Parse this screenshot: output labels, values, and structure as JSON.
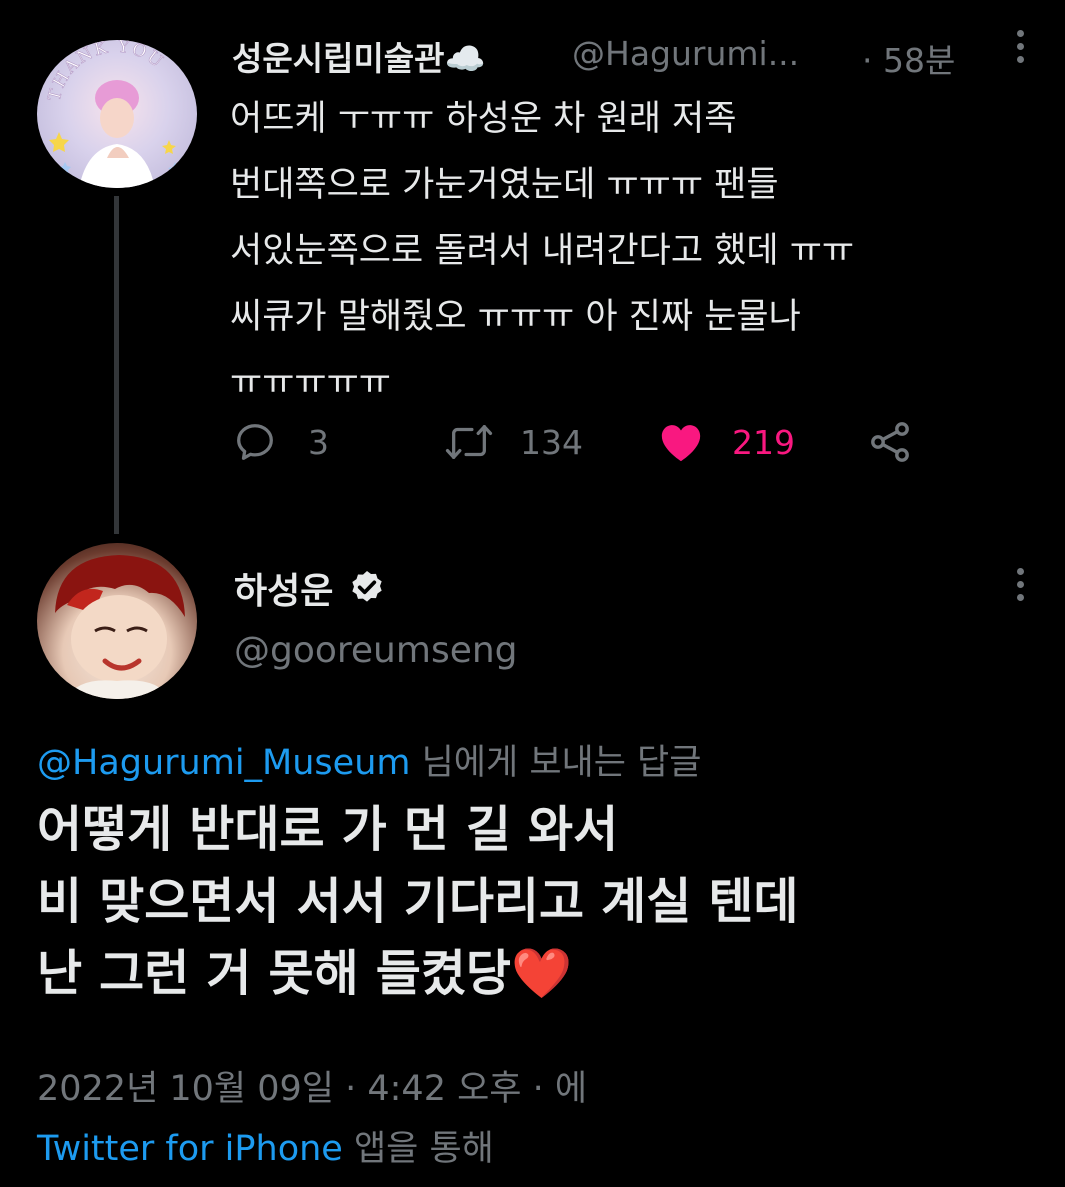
{
  "parent_tweet": {
    "display_name": "성운시립미술관☁️",
    "handle": "@Hagurumi...",
    "time": "· 58분",
    "text_lines": [
      "어뜨케 ㅜㅠㅠ 하성운 차 원래 저족",
      "번대쪽으로 가눈거였눈데 ㅠㅠㅠ 팬들",
      "서있눈쪽으로 돌려서 내려간다고 했데 ㅠㅠ",
      "씨큐가 말해줬오 ㅠㅠㅠ 아 진짜 눈물나",
      "ㅠㅠㅠㅠㅠ"
    ],
    "avatar_text": "THANK YOU",
    "replies": "3",
    "retweets": "134",
    "likes": "219",
    "liked": true
  },
  "main_tweet": {
    "display_name": "하성운",
    "verified": true,
    "handle": "@gooreumseng",
    "reply_to_mention": "@Hagurumi_Museum",
    "reply_to_suffix": " 님에게 보내는 답글",
    "text_lines": [
      "어떻게 반대로 가 먼 길 와서",
      "비 맞으면서 서서 기다리고 계실 텐데",
      "난 그런 거 못해 들켰당❤️"
    ],
    "timestamp": "2022년 10월 09일 · 4:42 오후 · 에",
    "source_app": "Twitter for iPhone",
    "source_suffix": " 앱을 통해"
  },
  "colors": {
    "background": "#000000",
    "text": "#e7e9ea",
    "muted": "#71767b",
    "link": "#1d9bf0",
    "like": "#f91880",
    "thread_line": "#333639"
  },
  "icons": {
    "reply": "reply-icon",
    "retweet": "retweet-icon",
    "like": "heart-icon",
    "share": "share-icon",
    "more": "more-icon",
    "verified": "verified-badge-icon"
  }
}
